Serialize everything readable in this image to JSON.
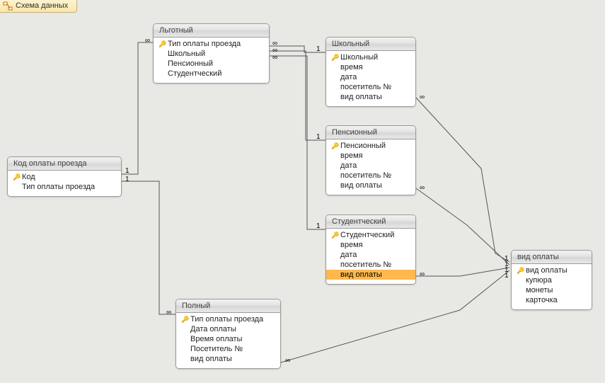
{
  "tab_title": "Схема данных",
  "tables": {
    "kod": {
      "title": "Код оплаты проезда",
      "fields": [
        {
          "name": "Код",
          "pk": true
        },
        {
          "name": "Тип оплаты проезда",
          "pk": false
        }
      ]
    },
    "lgot": {
      "title": "Льготный",
      "fields": [
        {
          "name": "Тип оплаты проезда",
          "pk": true
        },
        {
          "name": "Школьный",
          "pk": false
        },
        {
          "name": "Пенсионный",
          "pk": false
        },
        {
          "name": "Студентческий",
          "pk": false
        }
      ]
    },
    "shkol": {
      "title": "Школьный",
      "fields": [
        {
          "name": "Школьный",
          "pk": true
        },
        {
          "name": "время",
          "pk": false
        },
        {
          "name": "дата",
          "pk": false
        },
        {
          "name": "посетитель №",
          "pk": false
        },
        {
          "name": "вид оплаты",
          "pk": false
        }
      ]
    },
    "pens": {
      "title": "Пенсионный",
      "fields": [
        {
          "name": "Пенсионный",
          "pk": true
        },
        {
          "name": "время",
          "pk": false
        },
        {
          "name": "дата",
          "pk": false
        },
        {
          "name": "посетитель №",
          "pk": false
        },
        {
          "name": "вид оплаты",
          "pk": false
        }
      ]
    },
    "stud": {
      "title": "Студентческий",
      "fields": [
        {
          "name": "Студентческий",
          "pk": true
        },
        {
          "name": "время",
          "pk": false
        },
        {
          "name": "дата",
          "pk": false
        },
        {
          "name": "посетитель №",
          "pk": false
        },
        {
          "name": "вид оплаты",
          "pk": false,
          "selected": true
        }
      ]
    },
    "poln": {
      "title": "Полный",
      "fields": [
        {
          "name": "Тип оплаты проезда",
          "pk": true
        },
        {
          "name": "Дата оплаты",
          "pk": false
        },
        {
          "name": "Время оплаты",
          "pk": false
        },
        {
          "name": "Посетитель №",
          "pk": false
        },
        {
          "name": "вид оплаты",
          "pk": false
        }
      ]
    },
    "vid": {
      "title": "вид оплаты",
      "fields": [
        {
          "name": "вид оплаты",
          "pk": true
        },
        {
          "name": "купюра",
          "pk": false
        },
        {
          "name": "монеты",
          "pk": false
        },
        {
          "name": "карточка",
          "pk": false
        }
      ]
    }
  },
  "cardinality": {
    "one": "1",
    "many": "∞"
  },
  "relationships": [
    {
      "from": "kod",
      "to": "lgot",
      "from_card": "1",
      "to_card": "∞"
    },
    {
      "from": "kod",
      "to": "poln",
      "from_card": "1",
      "to_card": "∞"
    },
    {
      "from": "lgot",
      "to": "shkol",
      "from_card": "1",
      "to_card": "∞"
    },
    {
      "from": "lgot",
      "to": "pens",
      "from_card": "1",
      "to_card": "∞"
    },
    {
      "from": "lgot",
      "to": "stud",
      "from_card": "1",
      "to_card": "∞"
    },
    {
      "from": "shkol",
      "to": "vid",
      "from_card": "∞",
      "to_card": "1"
    },
    {
      "from": "pens",
      "to": "vid",
      "from_card": "∞",
      "to_card": "1"
    },
    {
      "from": "stud",
      "to": "vid",
      "from_card": "∞",
      "to_card": "1"
    },
    {
      "from": "poln",
      "to": "vid",
      "from_card": "∞",
      "to_card": "1"
    }
  ]
}
